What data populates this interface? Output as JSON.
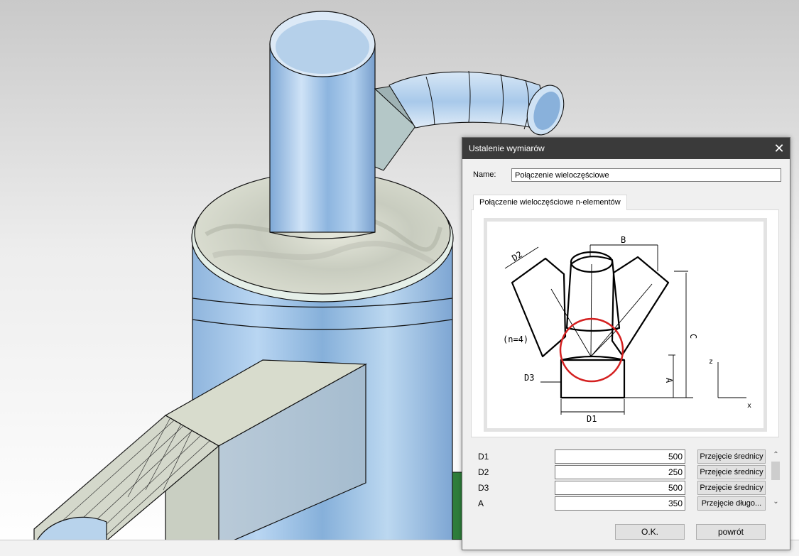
{
  "dialog": {
    "title": "Ustalenie wymiarów",
    "close_icon": "close-icon",
    "name_label": "Name:",
    "name_value": "Połączenie wieloczęściowe",
    "tab_label": "Połączenie wieloczęściowe n-elementów",
    "diagram": {
      "labels": {
        "d2": "D2",
        "b": "B",
        "c": "C",
        "n": "(n=4)",
        "d3": "D3",
        "a": "A",
        "d1": "D1",
        "z": "z",
        "x": "x"
      },
      "highlight_color": "#d42020"
    },
    "params": [
      {
        "label": "D1",
        "value": "500",
        "button": "Przejęcie średnicy"
      },
      {
        "label": "D2",
        "value": "250",
        "button": "Przejęcie średnicy"
      },
      {
        "label": "D3",
        "value": "500",
        "button": "Przejęcie średnicy"
      },
      {
        "label": "A",
        "value": "350",
        "button": "Przejęcie długo..."
      }
    ],
    "ok_label": "O.K.",
    "back_label": "powrót"
  },
  "colors": {
    "titlebar": "#3a3a3a",
    "dialog_bg": "#f0f0f0",
    "model_blue": "#9cc4e8"
  }
}
